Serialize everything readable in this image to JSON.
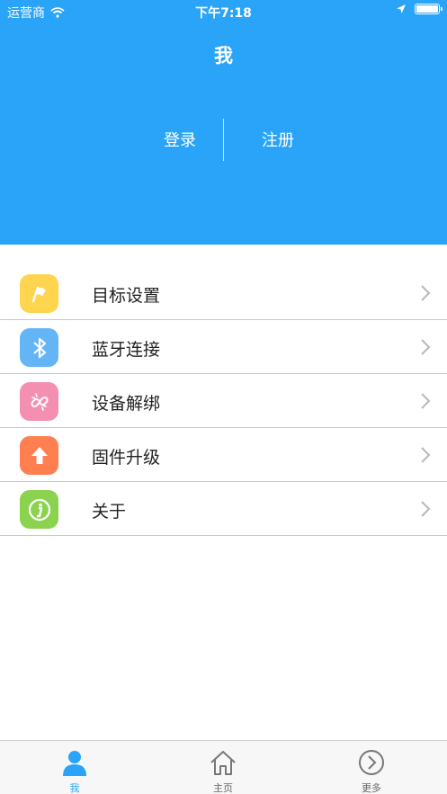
{
  "status_bar": {
    "carrier": "运营商",
    "time": "下午7:18"
  },
  "header": {
    "title": "我",
    "login_label": "登录",
    "register_label": "注册"
  },
  "menu": {
    "items": [
      {
        "label": "目标设置",
        "icon": "flag-icon",
        "color": "#ffd54f"
      },
      {
        "label": "蓝牙连接",
        "icon": "bluetooth-icon",
        "color": "#64b5f6"
      },
      {
        "label": "设备解绑",
        "icon": "unlink-icon",
        "color": "#f48fb1"
      },
      {
        "label": "固件升级",
        "icon": "upgrade-arrow-icon",
        "color": "#ff7f50"
      },
      {
        "label": "关于",
        "icon": "info-icon",
        "color": "#8bd34f"
      }
    ]
  },
  "tabbar": {
    "items": [
      {
        "label": "我",
        "icon": "person-icon",
        "active": true
      },
      {
        "label": "主页",
        "icon": "home-icon",
        "active": false
      },
      {
        "label": "更多",
        "icon": "chevron-circle-icon",
        "active": false
      }
    ]
  },
  "colors": {
    "primary": "#2aa4f8",
    "divider": "#c8c8c8"
  }
}
